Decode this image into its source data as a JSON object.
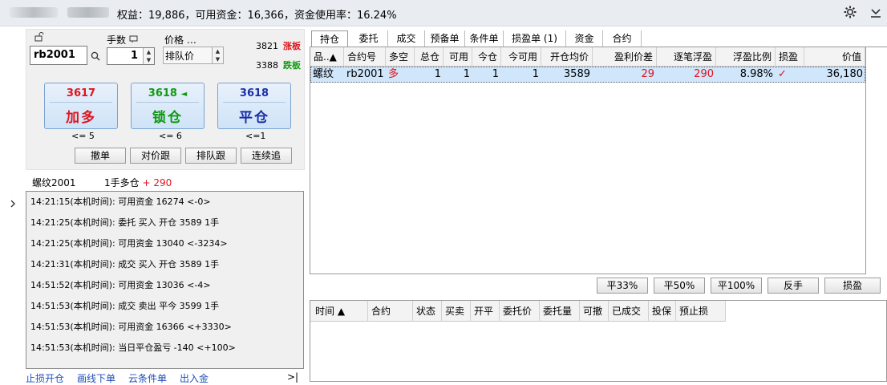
{
  "header": {
    "account_summary": "权益：19,886，可用资金：16,366，资金使用率：16.24%",
    "settings_icon": "gear-icon",
    "menu_icon": "chevron-down-icon"
  },
  "order_form": {
    "lock_icon": "lock-icon",
    "qty_label": "手数",
    "price_label": "价格 …",
    "contract": "rb2001",
    "search_icon": "search-icon",
    "quantity": "1",
    "price_type": "排队价",
    "limit_up_price": "3821",
    "limit_up_label": "涨板",
    "limit_down_price": "3388",
    "limit_down_label": "跌板"
  },
  "trade_buttons": [
    {
      "price": "3617",
      "label": "加多",
      "caption": "<= 5",
      "price_color": "#e0141e",
      "label_color": "#e0141e"
    },
    {
      "price": "3618",
      "price_suffix": "◄",
      "label": "锁仓",
      "caption": "<= 6",
      "price_color": "#109a10",
      "label_color": "#109a10"
    },
    {
      "price": "3618",
      "label": "平仓",
      "caption": "<=1",
      "price_color": "#1a2fa8",
      "label_color": "#1a2fa8"
    }
  ],
  "small_buttons": [
    "撤单",
    "对价跟",
    "排队跟",
    "连续追"
  ],
  "position_line": {
    "name": "螺纹2001",
    "detail": "1手多仓",
    "profit": "+ 290"
  },
  "log": [
    "14:21:15(本机时间): 可用资金 16274  <-0>",
    "14:21:25(本机时间): 委托  买入  开仓  3589  1手",
    "14:21:25(本机时间): 可用资金 13040  <-3234>",
    "14:21:31(本机时间): 成交  买入  开仓  3589  1手",
    "14:51:52(本机时间): 可用资金 13036  <-4>",
    "14:51:53(本机时间): 成交  卖出  平今  3599  1手",
    "14:51:53(本机时间): 可用资金 16366  <+3330>",
    "14:51:53(本机时间): 当日平仓盈亏 -140  <+100>"
  ],
  "bottom_links": [
    "止损开仓",
    "画线下单",
    "云条件单",
    "出入金"
  ],
  "bottom_right_glyph": ">|",
  "tabs": [
    "持仓",
    "委托",
    "成交",
    "预备单",
    "条件单",
    "损盈单 (1)",
    "资金",
    "合约"
  ],
  "position_table": {
    "headers": [
      "品..▲",
      "合约号",
      "多空",
      "总仓",
      "可用",
      "今仓",
      "今可用",
      "开仓均价",
      "盈利价差",
      "逐笔浮盈",
      "浮盈比例",
      "损盈",
      "价值"
    ],
    "rows": [
      [
        "螺纹",
        "rb2001",
        "多",
        "1",
        "1",
        "1",
        "1",
        "3589",
        "29",
        "290",
        "8.98%",
        "✓",
        "36,180"
      ]
    ]
  },
  "action_buttons": [
    "平33%",
    "平50%",
    "平100%",
    "反手",
    "损盈"
  ],
  "order_table": {
    "headers": [
      "时间 ▲",
      "合约",
      "状态",
      "买卖",
      "开平",
      "委托价",
      "委托量",
      "可撤",
      "已成交",
      "投保",
      "预止损"
    ]
  },
  "colors": {
    "buy": "#e0141e",
    "lock": "#109a10",
    "close": "#1a2fa8",
    "row_selected": "#cfe6fb"
  }
}
